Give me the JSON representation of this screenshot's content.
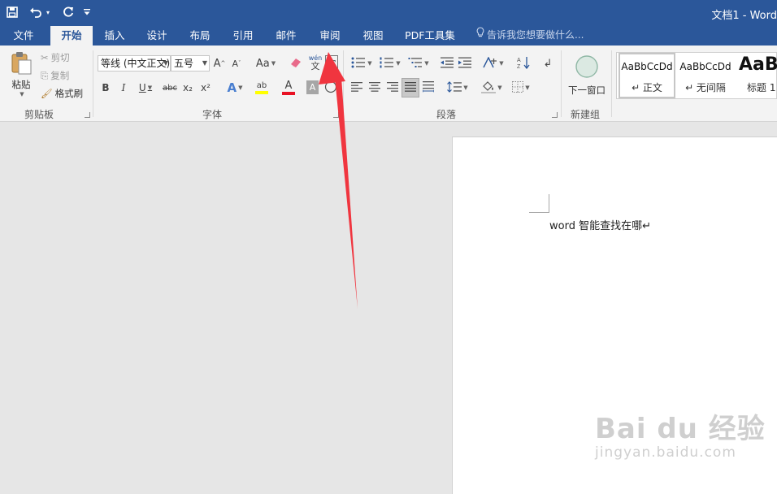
{
  "title_bar": {
    "doc_title": "文档1 - Word",
    "quick_access": [
      {
        "name": "save-icon",
        "glyph": "🖫"
      },
      {
        "name": "undo-icon",
        "glyph": "↶"
      },
      {
        "name": "undo-dropdown-icon",
        "glyph": "▾"
      },
      {
        "name": "redo-icon",
        "glyph": "↺"
      },
      {
        "name": "customize-qat-icon",
        "glyph": "⩤"
      }
    ],
    "background_color": "#2b579a"
  },
  "tabs": [
    {
      "label": "文件",
      "active": false
    },
    {
      "label": "开始",
      "active": true
    },
    {
      "label": "插入",
      "active": false
    },
    {
      "label": "设计",
      "active": false
    },
    {
      "label": "布局",
      "active": false
    },
    {
      "label": "引用",
      "active": false
    },
    {
      "label": "邮件",
      "active": false
    },
    {
      "label": "审阅",
      "active": false
    },
    {
      "label": "视图",
      "active": false
    },
    {
      "label": "PDF工具集",
      "active": false
    }
  ],
  "tell_me": {
    "placeholder": "告诉我您想要做什么...",
    "icon": "lightbulb-icon"
  },
  "ribbon": {
    "clipboard": {
      "label": "剪贴板",
      "paste": "粘贴",
      "cut": "剪切",
      "copy": "复制",
      "format_painter": "格式刷"
    },
    "font": {
      "label": "字体",
      "font_name": "等线 (中文正文)",
      "font_size": "五号",
      "grow": "A",
      "shrink": "A",
      "change_case": "Aa",
      "phonetic_top": "wén",
      "phonetic_bottom": "文",
      "bold": "B",
      "italic": "I",
      "underline": "U",
      "strikethrough": "abc",
      "subscript": "x₂",
      "superscript": "x²",
      "text_effects": "A",
      "highlight": "ab",
      "font_color": "A",
      "char_shading": "A",
      "enclose": "字",
      "highlight_color": "#ffff00",
      "font_color_bar": "#e81123"
    },
    "paragraph": {
      "label": "段落"
    },
    "new_group": {
      "label": "新建组",
      "button": "下一窗口"
    },
    "styles": {
      "items": [
        {
          "preview": "AaBbCcDd",
          "name": "↵ 正文"
        },
        {
          "preview": "AaBbCcDd",
          "name": "↵ 无间隔"
        },
        {
          "preview": "AaB",
          "name": "标题 1"
        }
      ]
    }
  },
  "document": {
    "text": "word 智能查找在哪↵"
  },
  "watermark": {
    "main": "Bai du 经验",
    "sub": "jingyan.baidu.com"
  },
  "annotation": {
    "arrow_color": "#f0353f"
  }
}
